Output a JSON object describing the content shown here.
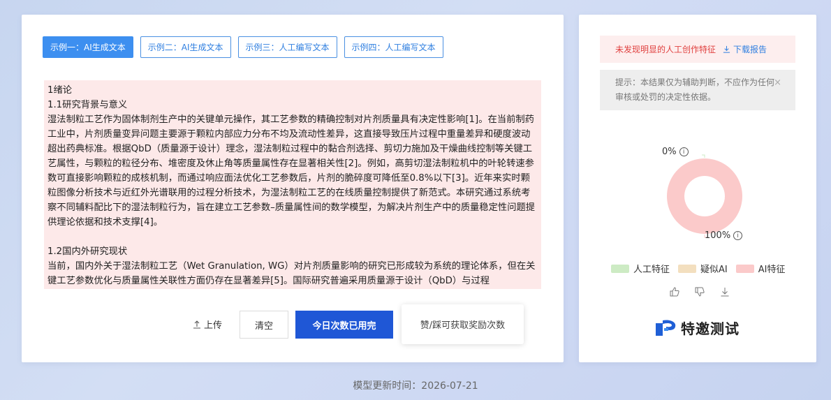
{
  "examples": [
    {
      "label": "示例一：AI生成文本",
      "active": true
    },
    {
      "label": "示例二：AI生成文本",
      "active": false
    },
    {
      "label": "示例三：人工编写文本",
      "active": false
    },
    {
      "label": "示例四：人工编写文本",
      "active": false
    }
  ],
  "text_lines": [
    "1绪论",
    "1.1研究背景与意义",
    "湿法制粒工艺作为固体制剂生产中的关键单元操作，其工艺参数的精确控制对片剂质量具有决定性影响[1]。在当前制药工业中，片剂质量变异问题主要源于颗粒内部应力分布不均及流动性差异，这直接导致压片过程中重量差异和硬度波动超出药典标准。根据QbD（质量源于设计）理念，湿法制粒过程中的黏合剂选择、剪切力施加及干燥曲线控制等关键工艺属性，与颗粒的粒径分布、堆密度及休止角等质量属性存在显著相关性[2]。例如，高剪切湿法制粒机中的叶轮转速参数可直接影响颗粒的成核机制，而通过响应面法优化工艺参数后，片剂的脆碎度可降低至0.8%以下[3]。近年来实时颗粒图像分析技术与近红外光谱联用的过程分析技术，为湿法制粒工艺的在线质量控制提供了新范式。本研究通过系统考察不同辅料配比下的湿法制粒行为，旨在建立工艺参数–质量属性间的数学模型，为解决片剂生产中的质量稳定性问题提供理论依据和技术支撑[4]。",
    "",
    "1.2国内外研究现状",
    "当前，国内外关于湿法制粒工艺（Wet Granulation, WG）对片剂质量影响的研究已形成较为系统的理论体系，但在关键工艺参数优化与质量属性关联性方面仍存在显著差异[5]。国际研究普遍采用质量源于设计（QbD）与过程"
  ],
  "actions": {
    "upload": "上传",
    "clear": "清空",
    "run": "今日次数已用完",
    "tip": "赞/踩可获取奖励次数"
  },
  "result": {
    "alert": "未发现明显的人工创作特征",
    "download": "下载报告",
    "notice": "提示：本结果仅为辅助判断，不应作为任何审核或处罚的决定性依据。",
    "close_glyph": "×"
  },
  "chart_data": {
    "type": "pie",
    "labels": [
      "人工特征",
      "疑似AI",
      "AI特征"
    ],
    "values": [
      0,
      0,
      100
    ],
    "colors": [
      "#cdebc4",
      "#f3dfbf",
      "#fbcaca"
    ],
    "annotations": [
      "0%",
      "100%"
    ]
  },
  "legend": [
    {
      "label": "人工特征",
      "color": "#cdebc4"
    },
    {
      "label": "疑似AI",
      "color": "#f3dfbf"
    },
    {
      "label": "AI特征",
      "color": "#fbcaca"
    }
  ],
  "brand": "特邀测试",
  "footer": "模型更新时间：2026-07-21"
}
